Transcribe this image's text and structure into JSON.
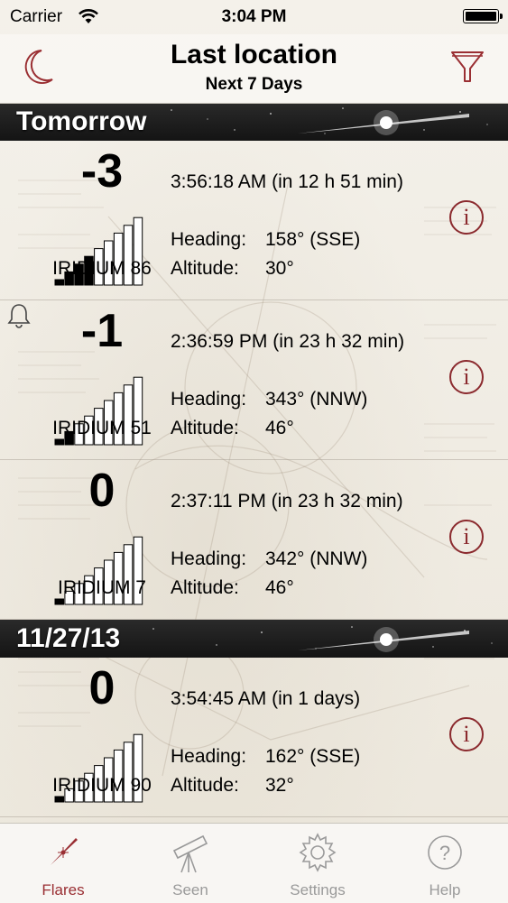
{
  "status_bar": {
    "carrier": "Carrier",
    "time": "3:04 PM",
    "battery_level": 1.0
  },
  "nav": {
    "title": "Last location",
    "subtitle": "Next 7 Days",
    "left_icon": "moon-icon",
    "right_icon": "filter-icon"
  },
  "colors": {
    "accent": "#9a2f33",
    "tab_inactive": "#9a9a9a"
  },
  "sections": [
    {
      "header": "Tomorrow",
      "rows": [
        {
          "magnitude": "-3",
          "satellite": "IRIDIUM 86",
          "datetime": "3:56:18 AM (in 12 h 51 min)",
          "heading_label": "Heading:",
          "heading": "158° (SSE)",
          "altitude_label": "Altitude:",
          "altitude": "30°",
          "filled_bars": 4,
          "bell": false
        },
        {
          "magnitude": "-1",
          "satellite": "IRIDIUM 51",
          "datetime": "2:36:59 PM (in 23 h 32 min)",
          "heading_label": "Heading:",
          "heading": "343° (NNW)",
          "altitude_label": "Altitude:",
          "altitude": "46°",
          "filled_bars": 2,
          "bell": true
        },
        {
          "magnitude": "0",
          "satellite": "IRIDIUM 7",
          "datetime": "2:37:11 PM (in 23 h 32 min)",
          "heading_label": "Heading:",
          "heading": "342° (NNW)",
          "altitude_label": "Altitude:",
          "altitude": "46°",
          "filled_bars": 1,
          "bell": false
        }
      ]
    },
    {
      "header": "11/27/13",
      "rows": [
        {
          "magnitude": "0",
          "satellite": "IRIDIUM 90",
          "datetime": "3:54:45 AM (in 1 days)",
          "heading_label": "Heading:",
          "heading": "162° (SSE)",
          "altitude_label": "Altitude:",
          "altitude": "32°",
          "filled_bars": 1,
          "bell": false
        }
      ]
    }
  ],
  "tabs": [
    {
      "label": "Flares",
      "icon": "flare-icon",
      "active": true
    },
    {
      "label": "Seen",
      "icon": "telescope-icon",
      "active": false
    },
    {
      "label": "Settings",
      "icon": "gear-icon",
      "active": false
    },
    {
      "label": "Help",
      "icon": "help-icon",
      "active": false
    }
  ]
}
